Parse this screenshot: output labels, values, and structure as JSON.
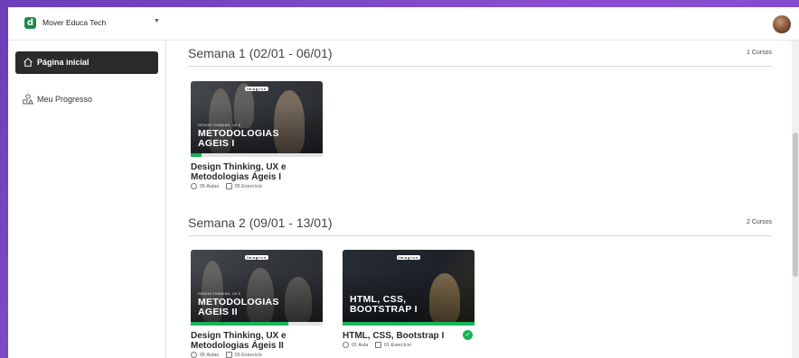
{
  "header": {
    "org_name": "Mover Educa Tech",
    "logo_letter": "d",
    "colors": {
      "brand": "#1e8a4b",
      "accent": "#1bb35a"
    }
  },
  "sidebar": {
    "items": [
      {
        "label": "Página inicial",
        "icon": "home-icon",
        "active": true
      },
      {
        "label": "Meu Progresso",
        "icon": "progress-shapes-icon",
        "active": false
      }
    ]
  },
  "weeks": [
    {
      "title": "Semana 1 (02/01 - 06/01)",
      "count": "1 Cursos",
      "courses": [
        {
          "brand": "Imagine",
          "kicker": "DESIGN THINKING, UX E",
          "thumb_title_1": "METODOLOGIAS",
          "thumb_title_2": "AGEIS I",
          "title_1": "Design Thinking, UX e",
          "title_2": "Metodologias Ágeis I",
          "lessons": "05 Aulas",
          "exercises": "05 Exercício",
          "progress": 0.08,
          "completed": false
        }
      ]
    },
    {
      "title": "Semana 2 (09/01 - 13/01)",
      "count": "2 Cursos",
      "courses": [
        {
          "brand": "Imagine",
          "kicker": "DESIGN THINKING, UX E",
          "thumb_title_1": "METODOLOGIAS",
          "thumb_title_2": "AGEIS II",
          "title_1": "Design Thinking, UX e",
          "title_2": "Metodologias Ágeis II",
          "lessons": "05 Aulas",
          "exercises": "05 Exercício",
          "progress": 0.74,
          "completed": false
        },
        {
          "brand": "Imagine",
          "kicker": "",
          "thumb_title_1": "HTML, CSS,",
          "thumb_title_2": "BOOTSTRAP I",
          "title_1": "HTML, CSS, Bootstrap I",
          "title_2": "",
          "lessons": "01 Aula",
          "exercises": "01 Exercício",
          "progress": 1.0,
          "completed": true
        }
      ]
    }
  ]
}
